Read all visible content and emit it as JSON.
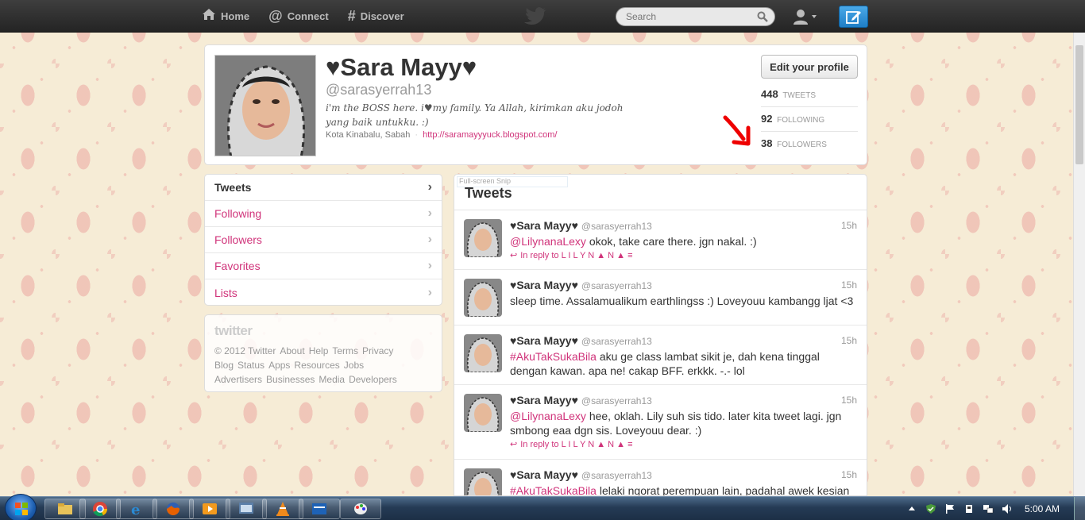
{
  "topbar": {
    "nav": [
      {
        "label": "Home",
        "icon": "home-icon"
      },
      {
        "label": "Connect",
        "icon": "at-icon"
      },
      {
        "label": "Discover",
        "icon": "hash-icon"
      }
    ],
    "search_placeholder": "Search"
  },
  "profile": {
    "name": "♥Sara Mayy♥",
    "handle": "@sarasyerrah13",
    "bio": "i'm the BOSS here. i♥my family. Ya Allah, kirimkan aku jodoh yang baik untukku. :)",
    "location": "Kota Kinabalu, Sabah",
    "url": "http://saramayyyuck.blogspot.com/",
    "edit_label": "Edit your profile",
    "stats": [
      {
        "value": "448",
        "label": "TWEETS"
      },
      {
        "value": "92",
        "label": "FOLLOWING"
      },
      {
        "value": "38",
        "label": "FOLLOWERS"
      }
    ]
  },
  "leftnav": [
    {
      "label": "Tweets"
    },
    {
      "label": "Following"
    },
    {
      "label": "Followers"
    },
    {
      "label": "Favorites"
    },
    {
      "label": "Lists"
    }
  ],
  "footer": {
    "logo": "twitter",
    "links": [
      "© 2012 Twitter",
      "About",
      "Help",
      "Terms",
      "Privacy",
      "Blog",
      "Status",
      "Apps",
      "Resources",
      "Jobs",
      "Advertisers",
      "Businesses",
      "Media",
      "Developers"
    ]
  },
  "stream": {
    "title": "Tweets",
    "snip_label": "Full-screen Snip",
    "tweets": [
      {
        "name": "♥Sara Mayy♥",
        "user": "@sarasyerrah13",
        "time": "15h",
        "mention": "@LilynanaLexy",
        "text": " okok, take care there. jgn nakal. :)",
        "reply": "In reply to L I L Y N ▲ N ▲ ≡"
      },
      {
        "name": "♥Sara Mayy♥",
        "user": "@sarasyerrah13",
        "time": "15h",
        "mention": "",
        "text": "sleep time. Assalamualikum earthlingss :) Loveyouu kambangg ljat <3",
        "reply": ""
      },
      {
        "name": "♥Sara Mayy♥",
        "user": "@sarasyerrah13",
        "time": "15h",
        "mention": "#AkuTakSukaBila",
        "text": " aku ge class lambat sikit je, dah kena tinggal dengan kawan. apa ne! cakap BFF. erkkk. -.- lol",
        "reply": ""
      },
      {
        "name": "♥Sara Mayy♥",
        "user": "@sarasyerrah13",
        "time": "15h",
        "mention": "@LilynanaLexy",
        "text": " hee, oklah. Lily suh sis tido. later kita tweet lagi. jgn smbong eaa dgn sis. Loveyouu dear. :)",
        "reply": "In reply to L I L Y N ▲ N ▲ ≡"
      },
      {
        "name": "♥Sara Mayy♥",
        "user": "@sarasyerrah13",
        "time": "15h",
        "mention": "#AkuTakSukaBila",
        "text": " lelaki ngorat perempuan lain, padahal awek kesian",
        "reply": ""
      }
    ]
  },
  "taskbar": {
    "clock": "5:00 AM"
  },
  "colors": {
    "link": "#d0337a",
    "topbar": "#2b2b2b",
    "compose": "#2b8cd6"
  }
}
